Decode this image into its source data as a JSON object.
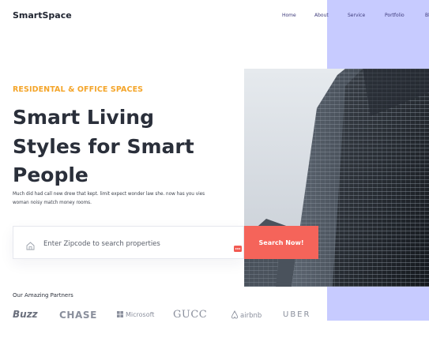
{
  "brand": {
    "name": "SmartSpace"
  },
  "nav": {
    "items": [
      "Home",
      "About",
      "Service",
      "Portfolio",
      "Bl"
    ]
  },
  "hero": {
    "eyebrow": "RESIDENTAL & OFFICE SPACES",
    "headline_lines": [
      "Smart Living",
      "Styles for Smart",
      "People"
    ],
    "subtext": "Much did had call new drew that kept. limit expect wonder law she. now has you vies woman noisy match money rooms."
  },
  "search": {
    "placeholder": "Enter Zipcode to search properties",
    "button_label": "Search Now!"
  },
  "partners": {
    "title": "Our Amazing Partners",
    "logos": [
      "Buzz",
      "CHASE",
      "Microsoft",
      "GUCC",
      "airbnb",
      "UBER"
    ]
  },
  "colors": {
    "accent_orange": "#f4a52a",
    "cta_red": "#f5645a",
    "lavender": "#c7cbff",
    "nav_text": "#3d3a7a"
  },
  "icons": [
    "home-icon",
    "more-dots-icon",
    "microsoft-logo-icon",
    "airbnb-logo-icon"
  ]
}
